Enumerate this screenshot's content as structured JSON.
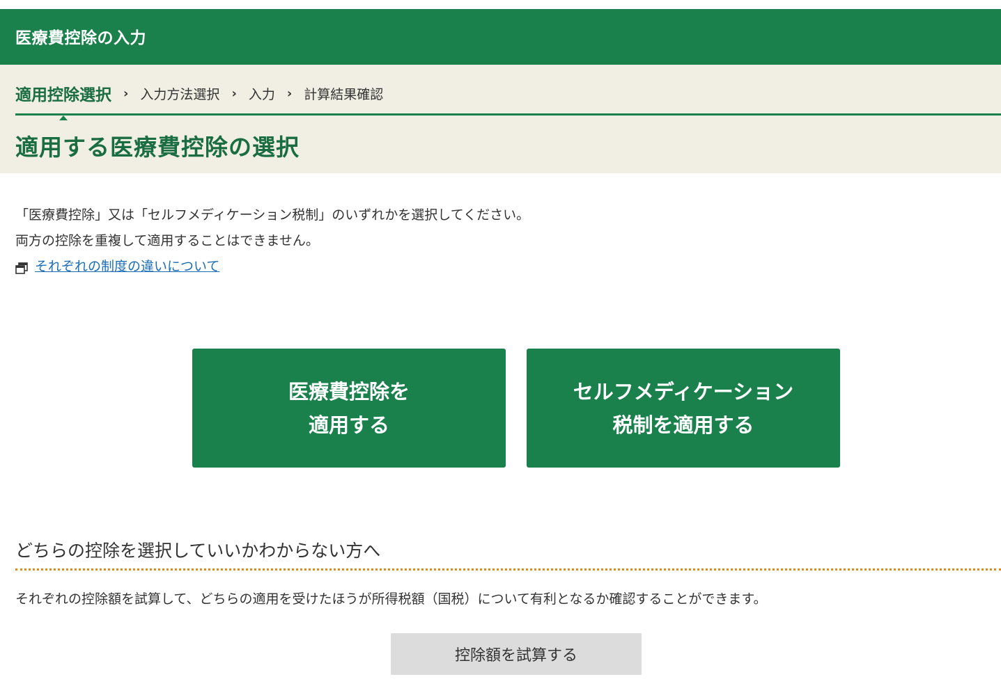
{
  "header": {
    "title": "医療費控除の入力"
  },
  "steps": {
    "items": [
      {
        "label": "適用控除選択"
      },
      {
        "label": "入力方法選択"
      },
      {
        "label": "入力"
      },
      {
        "label": "計算結果確認"
      }
    ],
    "active_index": 0
  },
  "page": {
    "title": "適用する医療費控除の選択",
    "description_line1": "「医療費控除」又は「セルフメディケーション税制」のいずれかを選択してください。",
    "description_line2": "両方の控除を重複して適用することはできません。",
    "link_text": "それぞれの制度の違いについて",
    "link_icon": "window-icon"
  },
  "choices": {
    "medical": {
      "line1": "医療費控除を",
      "line2": "適用する"
    },
    "selfmed": {
      "line1": "セルフメディケーション",
      "line2": "税制を適用する"
    }
  },
  "help_section": {
    "heading": "どちらの控除を選択していいかわからない方へ",
    "text": "それぞれの控除額を試算して、どちらの適用を受けたほうが所得税額（国税）について有利となるか確認することができます。",
    "button_label": "控除額を試算する"
  },
  "colors": {
    "brand_green": "#1a814d",
    "title_green": "#1a6d41",
    "band_beige": "#f1efe3",
    "link_blue": "#1b6eb5",
    "divider_orange": "#e08a1a",
    "button_gray": "#dcdcdc"
  }
}
